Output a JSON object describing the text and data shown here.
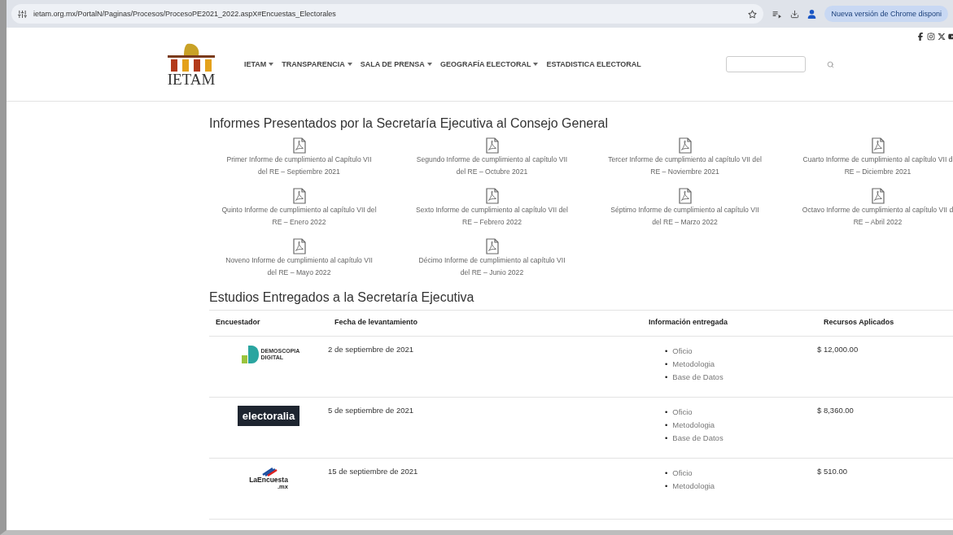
{
  "browser": {
    "url": "ietam.org.mx/PortalN/Paginas/Procesos/ProcesoPE2021_2022.aspX#Encuestas_Electorales",
    "update_notice": "Nueva versión de Chrome disponi"
  },
  "site": {
    "logo_text": "IETAM",
    "nav": [
      {
        "label": "IETAM",
        "dropdown": true
      },
      {
        "label": "TRANSPARENCIA",
        "dropdown": true
      },
      {
        "label": "SALA DE PRENSA",
        "dropdown": true
      },
      {
        "label": "GEOGRAFÍA ELECTORAL",
        "dropdown": true
      },
      {
        "label": "ESTADISTICA ELECTORAL",
        "dropdown": false
      }
    ]
  },
  "reports": {
    "title": "Informes Presentados por la Secretaría Ejecutiva al Consejo General",
    "items": [
      {
        "line1": "Primer Informe de cumplimiento al Capítulo VII",
        "line2": "del RE – Septiembre 2021"
      },
      {
        "line1": "Segundo Informe de cumplimiento al capítulo VII",
        "line2": "del RE – Octubre 2021"
      },
      {
        "line1": "Tercer Informe de cumplimiento al capítulo VII del",
        "line2": "RE – Noviembre 2021"
      },
      {
        "line1": "Cuarto Informe de cumplimiento al capítulo VII d",
        "line2": "RE – Diciembre 2021"
      },
      {
        "line1": "Quinto Informe de cumplimiento al capítulo VII del",
        "line2": "RE – Enero 2022"
      },
      {
        "line1": "Sexto Informe de cumplimiento al capítulo VII del",
        "line2": "RE – Febrero 2022"
      },
      {
        "line1": "Séptimo Informe de cumplimiento al capítulo VII",
        "line2": "del RE – Marzo 2022"
      },
      {
        "line1": "Octavo Informe de cumplimiento al capítulo VII d",
        "line2": "RE – Abril 2022"
      },
      {
        "line1": "Noveno Informe de cumplimiento al capítulo VII",
        "line2": "del RE – Mayo 2022"
      },
      {
        "line1": "Décimo Informe de cumplimiento al capítulo VII",
        "line2": "del RE – Junio 2022"
      }
    ]
  },
  "studies": {
    "title": "Estudios Entregados a la Secretaría Ejecutiva",
    "bullet": "•",
    "columns": [
      "Encuestador",
      "Fecha de levantamiento",
      "Información entregada",
      "Recursos Aplicados"
    ],
    "rows": [
      {
        "logo": {
          "kind": "demoscopia",
          "text": "DEMOSCOPIA DIGITAL"
        },
        "date": "2 de septiembre de 2021",
        "docs": [
          "Oficio",
          "Metodologia",
          "Base de Datos"
        ],
        "amount": "$ 12,000.00"
      },
      {
        "logo": {
          "kind": "electoralia",
          "text": "electoralia"
        },
        "date": "5 de septiembre de 2021",
        "docs": [
          "Oficio",
          "Metodologia",
          "Base de Datos"
        ],
        "amount": "$ 8,360.00"
      },
      {
        "logo": {
          "kind": "laencuesta",
          "text": "LaEncuesta",
          "suffix": ".mx"
        },
        "date": "15 de septiembre de 2021",
        "docs": [
          "Oficio",
          "Metodologia"
        ],
        "amount": "$ 510.00"
      }
    ]
  }
}
